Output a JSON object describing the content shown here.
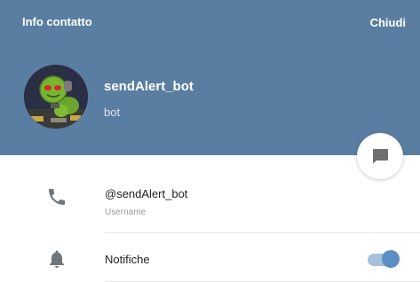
{
  "header": {
    "title": "Info contatto",
    "close_label": "Chiudi",
    "background_color": "#5a7ea1"
  },
  "contact": {
    "name": "sendAlert_bot",
    "status": "bot",
    "avatar_icon": "robot-avatar"
  },
  "actions": {
    "message_icon": "chat-bubble-icon"
  },
  "details": {
    "username": {
      "icon": "phone-icon",
      "value": "@sendAlert_bot",
      "label": "Username"
    },
    "notifications": {
      "icon": "bell-icon",
      "label": "Notifiche",
      "enabled": true,
      "accent_color": "#5b8ec4"
    }
  }
}
